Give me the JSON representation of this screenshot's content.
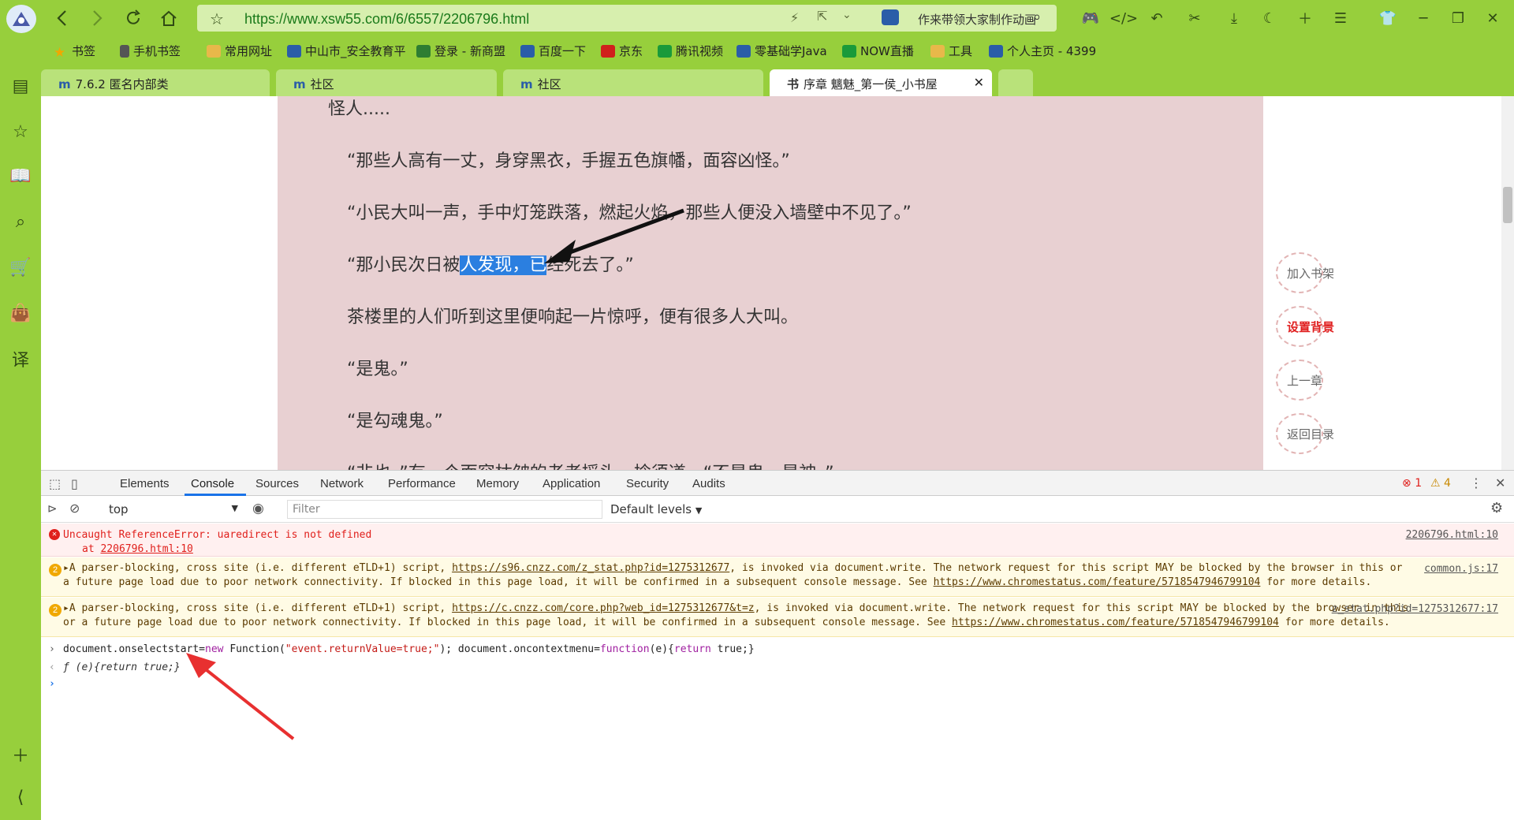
{
  "browser": {
    "url": "https://www.xsw55.com/6/6557/2206796.html",
    "search_text": "作来带领大家制作动画"
  },
  "bookmarks": [
    {
      "label": "书签",
      "color": "#f0a800"
    },
    {
      "label": "手机书签",
      "color": "#555555"
    },
    {
      "label": "常用网址",
      "color": "#e8b84a"
    },
    {
      "label": "中山市_安全教育平",
      "color": "#2a5da8"
    },
    {
      "label": "登录 - 新商盟",
      "color": "#2e7d32"
    },
    {
      "label": "百度一下",
      "color": "#2a5da8"
    },
    {
      "label": "京东",
      "color": "#d0201c"
    },
    {
      "label": "腾讯视频",
      "color": "#1a9a3a"
    },
    {
      "label": "零基础学Java",
      "color": "#2a5da8"
    },
    {
      "label": "NOW直播",
      "color": "#1a9a3a"
    },
    {
      "label": "工具",
      "color": "#e8b84a"
    },
    {
      "label": "个人主页 - 4399",
      "color": "#2a5da8"
    }
  ],
  "tabs": [
    {
      "label": "7.6.2 匿名内部类",
      "icon": "m"
    },
    {
      "label": "社区",
      "icon": "m"
    },
    {
      "label": "社区",
      "icon": "m"
    },
    {
      "label": "序章 魑魅_第一侯_小书屋",
      "icon": "书"
    }
  ],
  "reader": {
    "paragraphs": [
      "怪人.....",
      "“那些人高有一丈，身穿黑衣，手握五色旗幡，面容凶怪。”",
      "“小民大叫一声，手中灯笼跌落，燃起火焰，那些人便没入墙壁中不见了。”",
      "茶楼里的人们听到这里便响起一片惊呼，便有很多人大叫。",
      "“是鬼。”",
      "“是勾魂鬼。”",
      "“非也，”有一个面容枯皱的老者摇头，捻须道，“不是鬼，是神。”"
    ],
    "selected_line": {
      "before": "“那小民次日被",
      "selected": "人发现，已",
      "after": "经死去了。”"
    },
    "actions": [
      "加入书架",
      "设置背景",
      "上一章",
      "返回目录"
    ]
  },
  "devtools": {
    "tabs": [
      "Elements",
      "Console",
      "Sources",
      "Network",
      "Performance",
      "Memory",
      "Application",
      "Security",
      "Audits"
    ],
    "active_tab": "Console",
    "error_count": "1",
    "warning_count": "4",
    "context": "top",
    "filter_placeholder": "Filter",
    "levels": "Default levels",
    "messages": {
      "error": {
        "text": "Uncaught ReferenceError: uaredirect is not defined",
        "at": "at ",
        "at_link": "2206796.html:10",
        "source": "2206796.html:10"
      },
      "warn1": {
        "count": "2",
        "text_a": "A parser-blocking, cross site (i.e. different eTLD+1) script, ",
        "link_a": "https://s96.cnzz.com/z_stat.php?id=1275312677",
        "text_b": ", is invoked via document.write. The network request for this script MAY be blocked by the browser in this or a future page load due to poor network connectivity. If blocked in this page load, it will be confirmed in a subsequent console message. See ",
        "link_b": "https://www.chromestatus.com/feature/5718547946799104",
        "text_c": " for more details.",
        "source": "common.js:17"
      },
      "warn2": {
        "count": "2",
        "text_a": "A parser-blocking, cross site (i.e. different eTLD+1) script, ",
        "link_a": "https://c.cnzz.com/core.php?web_id=1275312677&t=z",
        "text_b": ", is invoked via document.write. The network request for this script MAY be blocked by the browser in this or a future page load due to poor network connectivity. If blocked in this page load, it will be confirmed in a subsequent console message. See ",
        "link_b": "https://www.chromestatus.com/feature/5718547946799104",
        "text_c": " for more details.",
        "source": "z_stat.php?id=1275312677:17"
      }
    },
    "input": {
      "p1": "document.onselectstart=",
      "kw1": "new",
      "p2": " Function(",
      "str1": "\"event.returnValue=true;\"",
      "p3": "); document.oncontextmenu=",
      "kw2": "function",
      "p4": "(e){",
      "kw3": "return",
      "p5": " true;}"
    },
    "result": "ƒ (e){return true;}"
  }
}
